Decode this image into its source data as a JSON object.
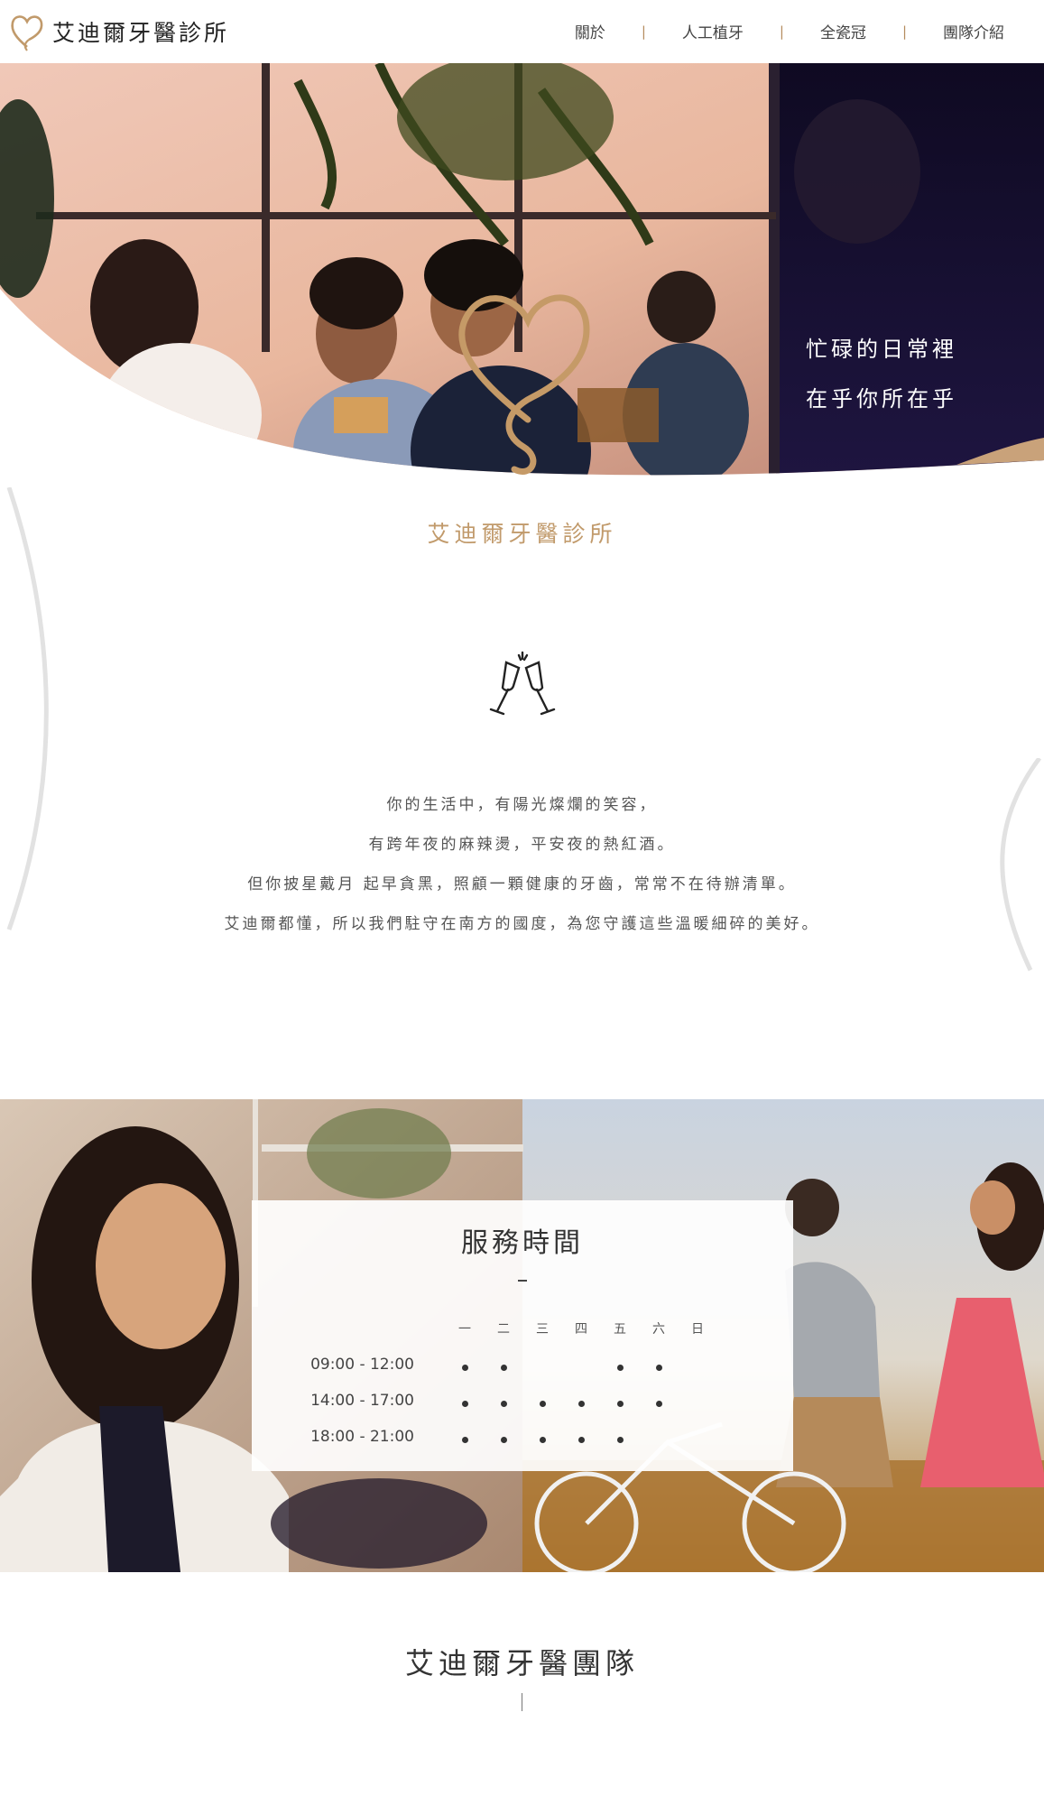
{
  "brand": {
    "name": "艾迪爾牙醫診所",
    "logo_icon": "heart-logo-icon",
    "accent": "#c19a6b"
  },
  "nav": {
    "items": [
      "關於",
      "人工植牙",
      "全瓷冠",
      "團隊介紹"
    ],
    "separator": "|"
  },
  "hero": {
    "lines": [
      "忙碌的日常裡",
      "在乎你所在乎"
    ]
  },
  "clinic_name": "艾迪爾牙醫診所",
  "intro": {
    "icon": "toast-glasses-icon",
    "lines": [
      "你的生活中，有陽光燦爛的笑容，",
      "有跨年夜的麻辣燙，平安夜的熱紅酒。",
      "但你披星戴月 起早貪黑，照顧一顆健康的牙齒，常常不在待辦清單。",
      "艾迪爾都懂，所以我們駐守在南方的國度，為您守護這些溫暖細碎的美好。"
    ]
  },
  "hours": {
    "title": "服務時間",
    "days": [
      "一",
      "二",
      "三",
      "四",
      "五",
      "六",
      "日"
    ],
    "slots": [
      {
        "time": "09:00 - 12:00",
        "open": [
          true,
          true,
          false,
          false,
          true,
          true,
          false
        ]
      },
      {
        "time": "14:00 - 17:00",
        "open": [
          true,
          true,
          true,
          true,
          true,
          true,
          false
        ]
      },
      {
        "time": "18:00 - 21:00",
        "open": [
          true,
          true,
          true,
          true,
          true,
          false,
          false
        ]
      }
    ]
  },
  "team": {
    "title": "艾迪爾牙醫團隊"
  }
}
